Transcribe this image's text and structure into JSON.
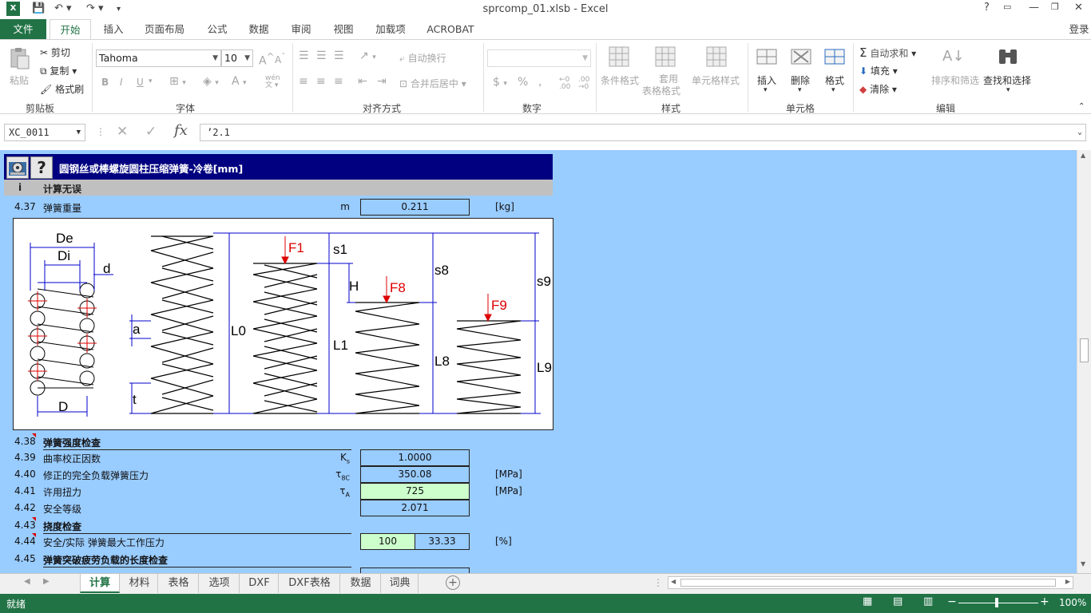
{
  "window": {
    "title": "sprcomp_01.xlsb - Excel",
    "help": "?",
    "login": "登录"
  },
  "ribbon_tabs": [
    "文件",
    "开始",
    "插入",
    "页面布局",
    "公式",
    "数据",
    "审阅",
    "视图",
    "加载项",
    "ACROBAT"
  ],
  "clipboard": {
    "paste": "粘贴",
    "cut": "剪切",
    "copy": "复制",
    "format_painter": "格式刷",
    "group": "剪贴板"
  },
  "font": {
    "name": "Tahoma",
    "size": "10",
    "bold": "B",
    "italic": "I",
    "underline": "U",
    "phonetic": "wén",
    "group": "字体"
  },
  "alignment": {
    "wrap": "自动换行",
    "merge": "合并后居中",
    "group": "对齐方式"
  },
  "number": {
    "currency": "$",
    "percent": "%",
    "comma": ",",
    "group": "数字"
  },
  "styles": {
    "conditional": "条件格式",
    "table_line1": "套用",
    "table_line2": "表格格式",
    "cell_styles": "单元格样式",
    "group": "样式"
  },
  "cells": {
    "insert": "插入",
    "delete": "删除",
    "format": "格式",
    "group": "单元格"
  },
  "editing": {
    "autosum": "自动求和",
    "fill": "填充",
    "clear": "清除",
    "sort": "排序和筛选",
    "find": "查找和选择",
    "group": "编辑"
  },
  "formula_bar": {
    "name_box": "XC_0011",
    "content": "’2.1",
    "fx": "fx"
  },
  "sheet": {
    "header_title": "圆钢丝或棒螺旋圆柱压缩弹簧-冷卷[mm]",
    "status_row": {
      "num": "i",
      "text": "计算无误"
    },
    "rows": [
      {
        "num": "4.37",
        "label": "弹簧重量",
        "sym": "m",
        "val": "0.211",
        "unit": "[kg]"
      }
    ],
    "rows2": [
      {
        "num": "4.38",
        "label": "弹簧强度检查",
        "bold": true
      },
      {
        "num": "4.39",
        "label": "曲率校正因数",
        "sym": "Ks",
        "val": "1.0000"
      },
      {
        "num": "4.40",
        "label": "修正的完全负载弹簧压力",
        "sym": "τ8C",
        "val": "350.08",
        "unit": "[MPa]"
      },
      {
        "num": "4.41",
        "label": "许用扭力",
        "sym": "τA",
        "val": "725",
        "unit": "[MPa]",
        "green": true
      },
      {
        "num": "4.42",
        "label": "安全等级",
        "val": "2.071"
      },
      {
        "num": "4.43",
        "label": "挠度检查",
        "bold": true
      },
      {
        "num": "4.44",
        "label": "安全/实际 弹簧最大工作压力",
        "val_a": "100",
        "val_b": "33.33",
        "unit": "[%]"
      },
      {
        "num": "4.45",
        "label": "弹簧突破疲劳负载的长度检查",
        "bold": true
      }
    ]
  },
  "diagram": {
    "De": "De",
    "Di": "Di",
    "d": "d",
    "D": "D",
    "a": "a",
    "t": "t",
    "L0": "L0",
    "L1": "L1",
    "L8": "L8",
    "L9": "L9",
    "F1": "F1",
    "F8": "F8",
    "F9": "F9",
    "s1": "s1",
    "s8": "s8",
    "s9": "s9",
    "H": "H"
  },
  "sheet_tabs": [
    "计算",
    "材料",
    "表格",
    "选项",
    "DXF",
    "DXF表格",
    "数据",
    "词典"
  ],
  "status": {
    "ready": "就绪",
    "zoom": "100%"
  }
}
